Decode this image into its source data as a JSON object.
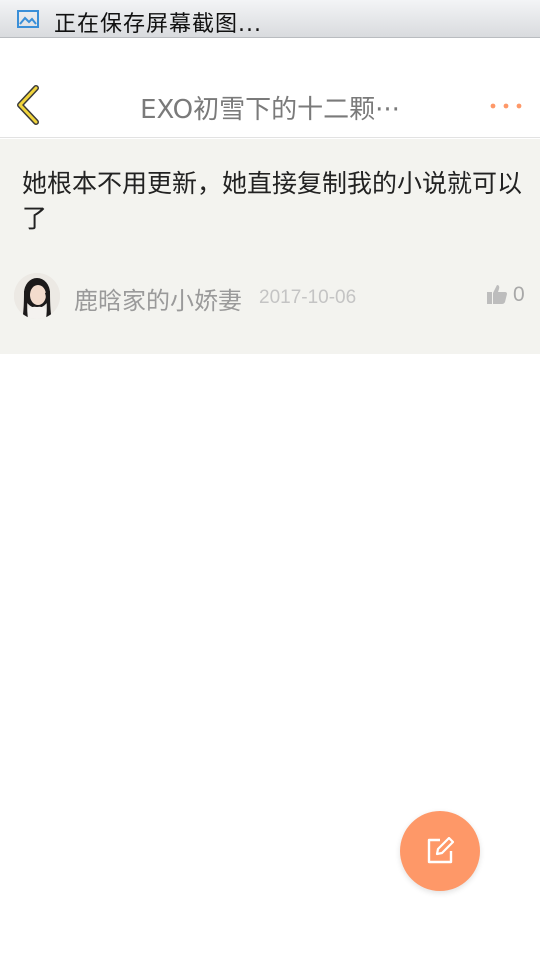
{
  "status_bar": {
    "text": "正在保存屏幕截图...",
    "icon": "image-icon"
  },
  "header": {
    "title": "EXO初雪下的十二颗···",
    "back_icon": "chevron-left-icon",
    "more_icon": "more-dots-icon",
    "accent_color": "#f0d43c",
    "more_color": "#fe9868"
  },
  "comment": {
    "text": "她根本不用更新，她直接复制我的小说就可以了",
    "author": "鹿晗家的小娇妻",
    "date": "2017-10-06",
    "like_count": "0",
    "like_icon": "thumbs-up-icon",
    "avatar": "avatar-photo"
  },
  "fab": {
    "icon": "edit-icon",
    "color": "#fe9868"
  }
}
